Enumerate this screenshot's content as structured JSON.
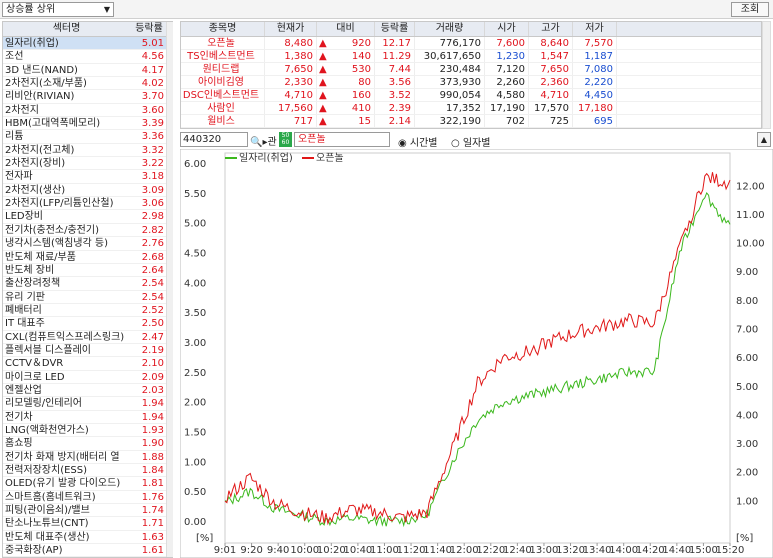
{
  "topbar": {
    "select_value": "상승률 상위",
    "query_button": "조회"
  },
  "sector_table": {
    "headers": [
      "섹터명",
      "등락률"
    ],
    "rows": [
      {
        "name": "일자리(취업)",
        "rate": "5.01"
      },
      {
        "name": "조선",
        "rate": "4.56"
      },
      {
        "name": "3D 낸드(NAND)",
        "rate": "4.17"
      },
      {
        "name": "2차전지(소재/부품)",
        "rate": "4.02"
      },
      {
        "name": "리비안(RIVIAN)",
        "rate": "3.70"
      },
      {
        "name": "2차전지",
        "rate": "3.60"
      },
      {
        "name": "HBM(고대역폭메모리)",
        "rate": "3.39"
      },
      {
        "name": "리튬",
        "rate": "3.36"
      },
      {
        "name": "2차전지(전고체)",
        "rate": "3.32"
      },
      {
        "name": "2차전지(장비)",
        "rate": "3.22"
      },
      {
        "name": "전자파",
        "rate": "3.18"
      },
      {
        "name": "2차전지(생산)",
        "rate": "3.09"
      },
      {
        "name": "2차전지(LFP/리튬인산철)",
        "rate": "3.06"
      },
      {
        "name": "LED장비",
        "rate": "2.98"
      },
      {
        "name": "전기차(충전소/충전기)",
        "rate": "2.82"
      },
      {
        "name": "냉각시스템(액침냉각 등)",
        "rate": "2.76"
      },
      {
        "name": "반도체 재료/부품",
        "rate": "2.68"
      },
      {
        "name": "반도체 장비",
        "rate": "2.64"
      },
      {
        "name": "출산장려정책",
        "rate": "2.54"
      },
      {
        "name": "유리 기판",
        "rate": "2.54"
      },
      {
        "name": "폐배터리",
        "rate": "2.52"
      },
      {
        "name": "IT 대표주",
        "rate": "2.50"
      },
      {
        "name": "CXL(컴퓨트익스프레스링크)",
        "rate": "2.47"
      },
      {
        "name": "플렉서블 디스플레이",
        "rate": "2.19"
      },
      {
        "name": "CCTV＆DVR",
        "rate": "2.10"
      },
      {
        "name": "마이크로 LED",
        "rate": "2.09"
      },
      {
        "name": "엔젤산업",
        "rate": "2.03"
      },
      {
        "name": "리모델링/인테리어",
        "rate": "1.94"
      },
      {
        "name": "전기차",
        "rate": "1.94"
      },
      {
        "name": "LNG(액화천연가스)",
        "rate": "1.93"
      },
      {
        "name": "홈쇼핑",
        "rate": "1.90"
      },
      {
        "name": "전기차 화재 방지(배터리 열",
        "rate": "1.88"
      },
      {
        "name": "전력저장장치(ESS)",
        "rate": "1.84"
      },
      {
        "name": "OLED(유기 발광 다이오드)",
        "rate": "1.81"
      },
      {
        "name": "스마트홈(홈네트워크)",
        "rate": "1.76"
      },
      {
        "name": "피팅(관이음쇠)/밸브",
        "rate": "1.74"
      },
      {
        "name": "탄소나노튜브(CNT)",
        "rate": "1.71"
      },
      {
        "name": "반도체 대표주(생산)",
        "rate": "1.63"
      },
      {
        "name": "중국화장(AP)",
        "rate": "1.61"
      }
    ]
  },
  "stock_table": {
    "headers": [
      "종목명",
      "현재가",
      "대비",
      "등락률",
      "거래량",
      "시가",
      "고가",
      "저가"
    ],
    "rows": [
      {
        "name": "오픈놀",
        "price": "8,480",
        "change": "920",
        "rate": "12.17",
        "volume": "776,170",
        "open": "7,600",
        "high": "8,640",
        "low": "7,570"
      },
      {
        "name": "TS인베스트먼트",
        "price": "1,380",
        "change": "140",
        "rate": "11.29",
        "volume": "30,617,650",
        "open": "1,230",
        "high": "1,547",
        "low": "1,187"
      },
      {
        "name": "원티드랩",
        "price": "7,650",
        "change": "530",
        "rate": "7.44",
        "volume": "230,484",
        "open": "7,120",
        "high": "7,650",
        "low": "7,080"
      },
      {
        "name": "아이비김영",
        "price": "2,330",
        "change": "80",
        "rate": "3.56",
        "volume": "373,930",
        "open": "2,260",
        "high": "2,360",
        "low": "2,220"
      },
      {
        "name": "DSC인베스트먼트",
        "price": "4,710",
        "change": "160",
        "rate": "3.52",
        "volume": "990,054",
        "open": "4,580",
        "high": "4,710",
        "low": "4,450"
      },
      {
        "name": "사람인",
        "price": "17,560",
        "change": "410",
        "rate": "2.39",
        "volume": "17,352",
        "open": "17,190",
        "high": "17,570",
        "low": "17,180"
      },
      {
        "name": "윌비스",
        "price": "717",
        "change": "15",
        "rate": "2.14",
        "volume": "322,190",
        "open": "702",
        "high": "725",
        "low": "695"
      }
    ]
  },
  "controls": {
    "code": "440320",
    "badge": "50 60",
    "stock_name": "오픈놀",
    "radio_time": "시간별",
    "radio_day": "일자별"
  },
  "chart_data": {
    "type": "line",
    "legend": [
      "일자리(취업)",
      "오픈놀"
    ],
    "colors": {
      "sector": "#3cb81e",
      "stock": "#e01818"
    },
    "x_ticks": [
      "9:01",
      "9:20",
      "9:40",
      "10:00",
      "10:20",
      "10:40",
      "11:00",
      "11:20",
      "11:40",
      "12:00",
      "12:20",
      "12:40",
      "13:00",
      "13:20",
      "13:40",
      "14:00",
      "14:20",
      "14:40",
      "15:00",
      "15:20"
    ],
    "left_axis": {
      "ticks": [
        "6.00",
        "5.50",
        "5.00",
        "4.50",
        "4.00",
        "3.50",
        "3.00",
        "2.50",
        "2.00",
        "1.50",
        "1.00",
        "0.50",
        "0.00"
      ],
      "unit": "[%]",
      "ylim": [
        0,
        6
      ]
    },
    "right_axis": {
      "ticks": [
        "12.00",
        "11.00",
        "10.00",
        "9.00",
        "8.00",
        "7.00",
        "6.00",
        "5.00",
        "4.00",
        "3.00",
        "2.00",
        "1.00"
      ],
      "unit": "[%]",
      "ylim": [
        0,
        12.5
      ]
    },
    "series": [
      {
        "name": "일자리(취업)",
        "axis": "left",
        "values": [
          0.3,
          0.5,
          0.2,
          0.1,
          0.0,
          0.05,
          0.0,
          0.0,
          0.1,
          1.0,
          1.7,
          2.0,
          2.1,
          2.2,
          2.3,
          2.4,
          2.5,
          2.5,
          4.5,
          5.5,
          4.9
        ]
      },
      {
        "name": "오픈놀",
        "axis": "right",
        "values": [
          0.8,
          1.5,
          0.6,
          0.3,
          0.1,
          0.4,
          0.3,
          0.1,
          0.3,
          2.5,
          4.8,
          5.7,
          5.9,
          6.3,
          6.6,
          6.8,
          7.0,
          6.9,
          9.5,
          12.0,
          11.8
        ]
      }
    ]
  }
}
